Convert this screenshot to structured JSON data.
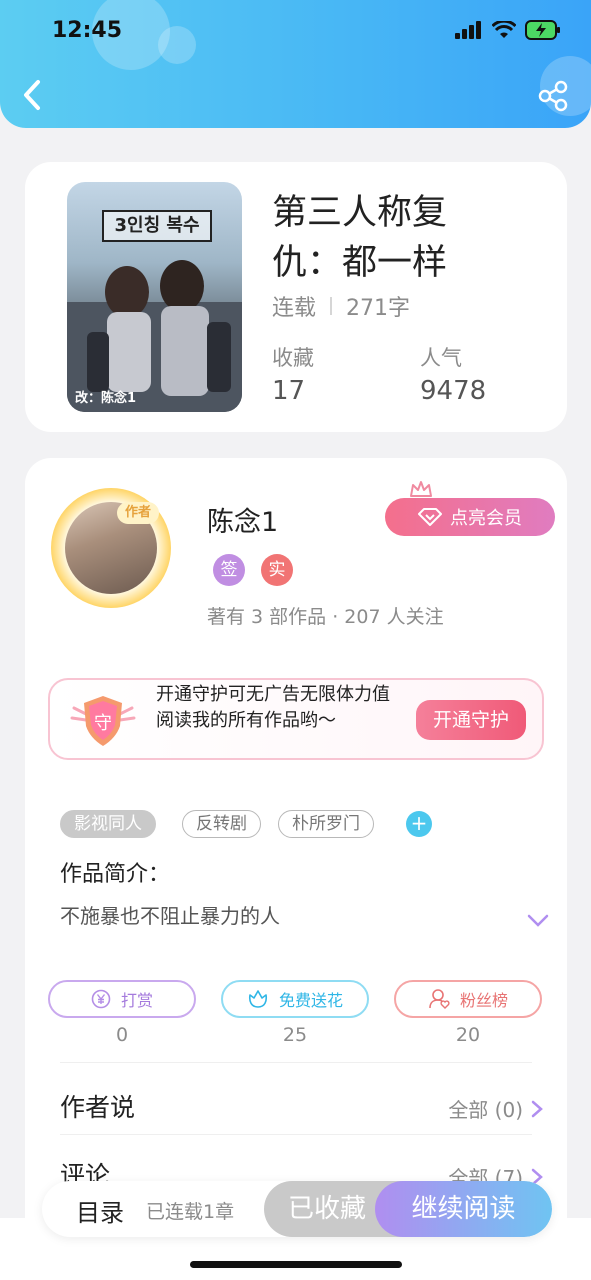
{
  "status_bar": {
    "time": "12:45"
  },
  "book": {
    "title": "第三人称复仇：都一样",
    "status": "连载",
    "word_count": "271字",
    "cover_text": "改：陈念1",
    "cover_title": "3인칭 복수",
    "favorites_label": "收藏",
    "favorites_value": "17",
    "popularity_label": "人气",
    "popularity_value": "9478"
  },
  "author": {
    "tag": "作者",
    "name": "陈念1",
    "badge_sign": "签",
    "badge_real": "实",
    "stats": "著有 3 部作品 · 207 人关注",
    "vip_button": "点亮会员"
  },
  "guard": {
    "shield_text": "守",
    "text": "开通守护可无广告无限体力值阅读我的所有作品哟～",
    "button": "开通守护"
  },
  "tags": [
    "影视同人",
    "反转剧",
    "朴所罗门"
  ],
  "intro": {
    "title": "作品简介：",
    "text": "不施暴也不阻止暴力的人"
  },
  "actions": [
    {
      "label": "打赏",
      "count": "0",
      "icon": "yen-icon",
      "color": "#b48ee6"
    },
    {
      "label": "免费送花",
      "count": "25",
      "icon": "flower-icon",
      "color": "#4cc8ee"
    },
    {
      "label": "粉丝榜",
      "count": "20",
      "icon": "fans-icon",
      "color": "#f08a8a"
    }
  ],
  "author_says": {
    "title": "作者说",
    "link": "全部 (0)"
  },
  "comments": {
    "title": "评论",
    "link": "全部 (7)"
  },
  "bottom_bar": {
    "toc": "目录",
    "serial": "已连载1章",
    "collected": "已收藏",
    "read": "继续阅读"
  },
  "colors": {
    "header_gradient_start": "#5ccdf2",
    "header_gradient_end": "#3aa4f8",
    "accent_pink": "#f05a78",
    "accent_purple": "#b08ef0"
  }
}
